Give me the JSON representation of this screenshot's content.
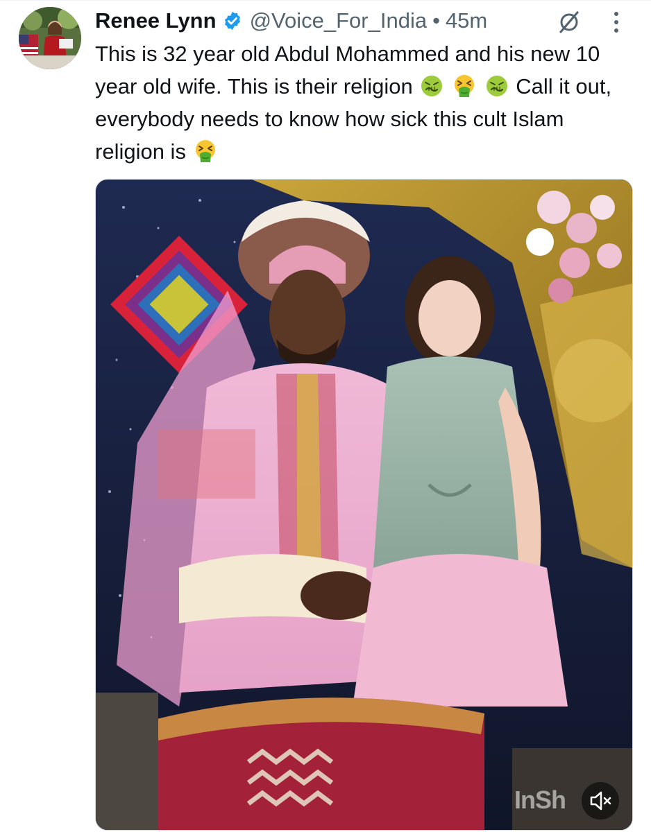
{
  "post": {
    "author_name": "Renee Lynn",
    "author_handle": "@Voice_For_India",
    "separator": "•",
    "time_ago": "45m",
    "text_parts": {
      "p1": "This is 32 year old Abdul Mohammed and his new 10 year old wife. This is their religion",
      "p2": "Call it out, everybody needs to know how sick this cult Islam religion is"
    },
    "media_watermark": "InSh",
    "icons": {
      "verified": "verified-badge-icon",
      "grok": "grok-icon",
      "more": "more-options-icon",
      "nauseated": "nauseated-face-emoji",
      "vomiting": "vomiting-face-emoji",
      "mute": "volume-muted-icon"
    }
  },
  "colors": {
    "verified_blue": "#1d9bf0",
    "secondary_text": "#536471",
    "primary_text": "#0f1419"
  }
}
